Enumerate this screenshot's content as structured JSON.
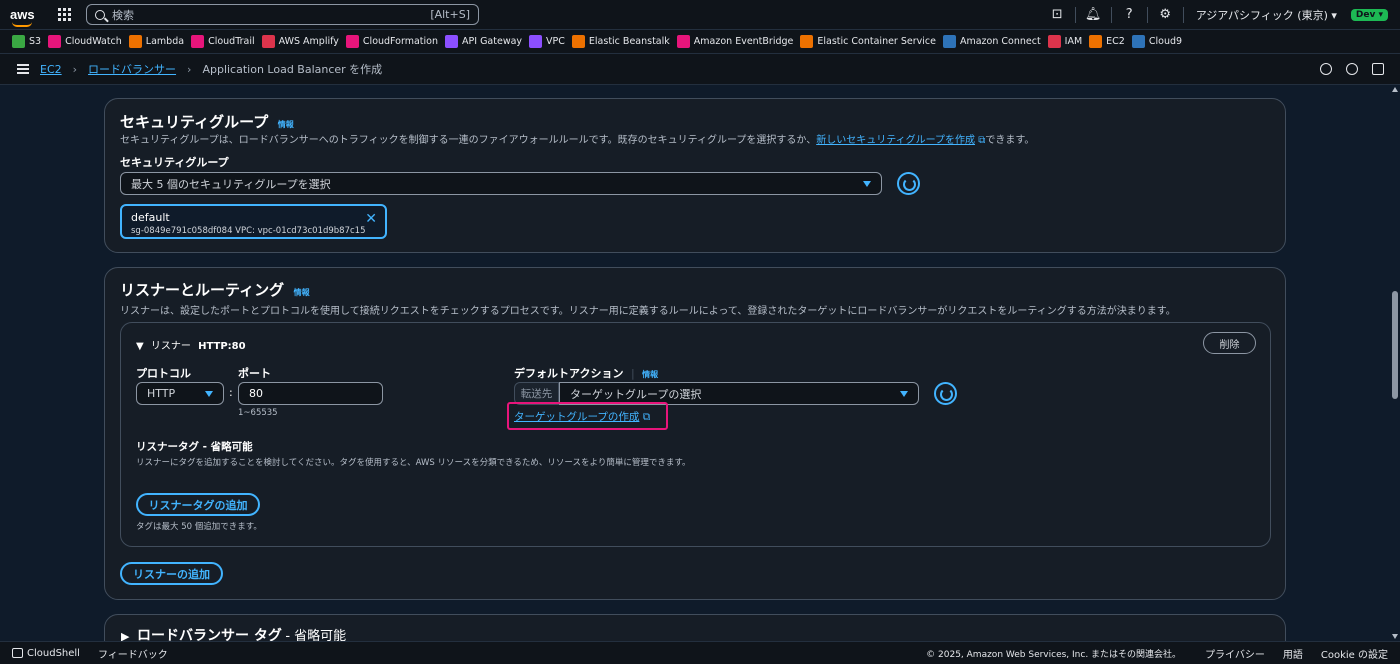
{
  "nav": {
    "logo": "aws",
    "search_placeholder": "検索",
    "search_shortcut": "[Alt+S]",
    "region": "アジアパシフィック (東京) ▾",
    "account_badge": "Dev ▾"
  },
  "favorites": [
    {
      "label": "S3",
      "color": "#3aa843"
    },
    {
      "label": "CloudWatch",
      "color": "#e7157b"
    },
    {
      "label": "Lambda",
      "color": "#ed7100"
    },
    {
      "label": "CloudTrail",
      "color": "#e7157b"
    },
    {
      "label": "AWS Amplify",
      "color": "#dd344c"
    },
    {
      "label": "CloudFormation",
      "color": "#e7157b"
    },
    {
      "label": "API Gateway",
      "color": "#8c4fff"
    },
    {
      "label": "VPC",
      "color": "#8c4fff"
    },
    {
      "label": "Elastic Beanstalk",
      "color": "#ed7100"
    },
    {
      "label": "Amazon EventBridge",
      "color": "#e7157b"
    },
    {
      "label": "Elastic Container Service",
      "color": "#ed7100"
    },
    {
      "label": "Amazon Connect",
      "color": "#2e73b8"
    },
    {
      "label": "IAM",
      "color": "#dd344c"
    },
    {
      "label": "EC2",
      "color": "#ed7100"
    },
    {
      "label": "Cloud9",
      "color": "#2e73b8"
    }
  ],
  "breadcrumb": {
    "item1": "EC2",
    "item2": "ロードバランサー",
    "current": "Application Load Balancer を作成"
  },
  "security": {
    "title": "セキュリティグループ",
    "info": "情報",
    "desc_pre": "セキュリティグループは、ロードバランサーへのトラフィックを制御する一連のファイアウォールルールです。既存のセキュリティグループを選択するか、",
    "desc_link": "新しいセキュリティグループを作成",
    "desc_post": "できます。",
    "field_label": "セキュリティグループ",
    "select_placeholder": "最大 5 個のセキュリティグループを選択",
    "token_name": "default",
    "token_detail": "sg-0849e791c058df084    VPC: vpc-01cd73c01d9b87c15"
  },
  "listener_section": {
    "title": "リスナーとルーティング",
    "info": "情報",
    "desc": "リスナーは、設定したポートとプロトコルを使用して接続リクエストをチェックするプロセスです。リスナー用に定義するルールによって、登録されたターゲットにロードバランサーがリクエストをルーティングする方法が決まります。",
    "listener_label": "リスナー",
    "listener_name": "HTTP:80",
    "remove_button": "削除",
    "protocol_label": "プロトコル",
    "protocol_value": "HTTP",
    "port_label": "ポート",
    "port_value": "80",
    "port_hint": "1~65535",
    "default_action_label": "デフォルトアクション",
    "default_action_info": "情報",
    "forward_prefix": "転送先",
    "target_group_placeholder": "ターゲットグループの選択",
    "create_target_group_link": "ターゲットグループの作成",
    "tags_title": "リスナータグ - 省略可能",
    "tags_desc": "リスナーにタグを追加することを検討してください。タグを使用すると、AWS リソースを分類できるため、リソースをより簡単に管理できます。",
    "add_tag_button": "リスナータグの追加",
    "tag_limit": "タグは最大 50 個追加できます。",
    "add_listener_button": "リスナーの追加"
  },
  "lb_tags": {
    "title": "ロードバランサー タグ",
    "suffix": "- 省略可能"
  },
  "footer": {
    "cloudshell": "CloudShell",
    "feedback": "フィードバック",
    "copyright": "© 2025, Amazon Web Services, Inc. またはその関連会社。",
    "privacy": "プライバシー",
    "terms": "用語",
    "cookie": "Cookie の設定"
  }
}
